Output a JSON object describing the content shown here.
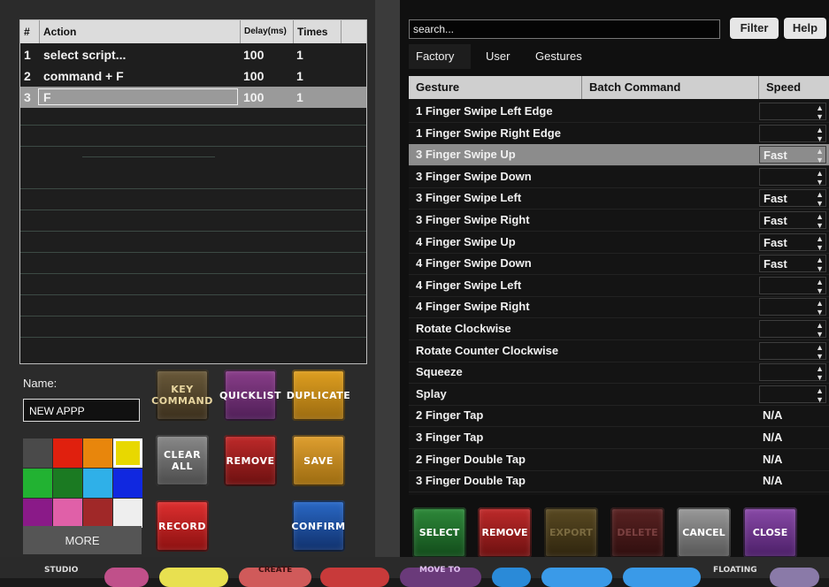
{
  "action_table": {
    "headers": {
      "num": "#",
      "action": "Action",
      "delay": "Delay(ms)",
      "times": "Times"
    },
    "rows": [
      {
        "num": "1",
        "action": "select script...",
        "delay": "100",
        "times": "1"
      },
      {
        "num": "2",
        "action": "command + F",
        "delay": "100",
        "times": "1"
      },
      {
        "num": "3",
        "action": "F",
        "delay": "100",
        "times": "1",
        "selected": true
      }
    ]
  },
  "name": {
    "label": "Name:",
    "value": "NEW APPP"
  },
  "buttons": {
    "key_command_1": "KEY",
    "key_command_2": "COMMAND",
    "quicklist": "QUICKLIST",
    "duplicate": "DUPLICATE",
    "clear_all_1": "CLEAR",
    "clear_all_2": "ALL",
    "remove": "REMOVE",
    "save": "SAVE",
    "record": "RECORD",
    "confirm": "CONFIRM",
    "more": "MORE"
  },
  "colors": [
    "#4a4a4a",
    "#e0200e",
    "#e8860c",
    "#e8d800",
    "#22b232",
    "#1b7a22",
    "#2fb0e8",
    "#1028e0",
    "#8a1a88",
    "#e060a8",
    "#a02828",
    "#eeeeee"
  ],
  "search": {
    "value": "search...",
    "filter": "Filter",
    "help": "Help"
  },
  "tabs": [
    "Factory",
    "User",
    "Gestures"
  ],
  "gesture_table": {
    "headers": {
      "gesture": "Gesture",
      "batch": "Batch Command",
      "speed": "Speed"
    },
    "rows": [
      {
        "gesture": "1 Finger Swipe Left Edge",
        "speed": ""
      },
      {
        "gesture": "1 Finger Swipe Right Edge",
        "speed": ""
      },
      {
        "gesture": "3 Finger Swipe Up",
        "speed": "Fast",
        "selected": true
      },
      {
        "gesture": "3 Finger Swipe Down",
        "speed": ""
      },
      {
        "gesture": "3 Finger Swipe Left",
        "speed": "Fast"
      },
      {
        "gesture": "3 Finger Swipe Right",
        "speed": "Fast"
      },
      {
        "gesture": "4 Finger Swipe Up",
        "speed": "Fast"
      },
      {
        "gesture": "4 Finger Swipe Down",
        "speed": "Fast"
      },
      {
        "gesture": "4 Finger Swipe Left",
        "speed": ""
      },
      {
        "gesture": "4 Finger Swipe Right",
        "speed": ""
      },
      {
        "gesture": "Rotate Clockwise",
        "speed": ""
      },
      {
        "gesture": "Rotate Counter Clockwise",
        "speed": ""
      },
      {
        "gesture": "Squeeze",
        "speed": ""
      },
      {
        "gesture": "Splay",
        "speed": ""
      },
      {
        "gesture": "2 Finger Tap",
        "speed": "N/A",
        "na": true
      },
      {
        "gesture": "3 Finger Tap",
        "speed": "N/A",
        "na": true
      },
      {
        "gesture": "2 Finger Double Tap",
        "speed": "N/A",
        "na": true
      },
      {
        "gesture": "3 Finger Double Tap",
        "speed": "N/A",
        "na": true
      }
    ]
  },
  "bottom_buttons": {
    "select": "SELECT",
    "remove": "REMOVE",
    "export": "EXPORT",
    "delete": "DELETE",
    "cancel": "CANCEL",
    "close": "CLOSE"
  },
  "dock": {
    "studio": "STUDIO",
    "create": "CREATE",
    "move_to": "MOVE TO",
    "floating": "FLOATING"
  }
}
